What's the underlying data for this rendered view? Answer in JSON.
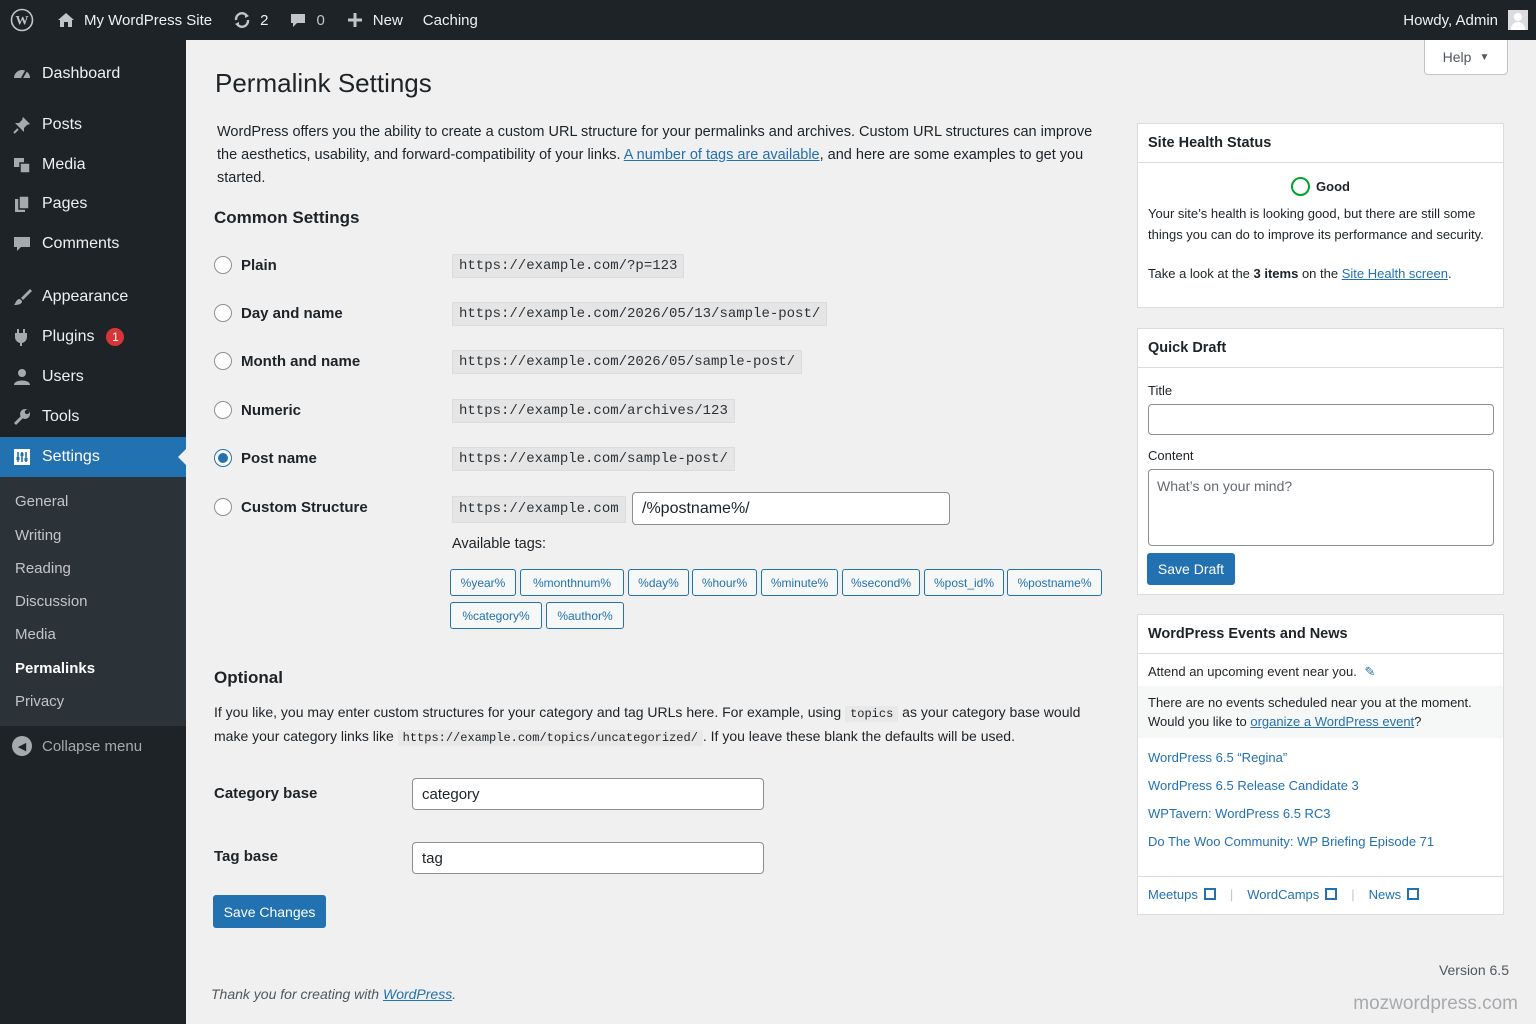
{
  "admin_bar": {
    "site_name": "My WordPress Site",
    "updates_count": "2",
    "comments_count": "0",
    "new_label": "New",
    "caching_label": "Caching",
    "howdy": "Howdy, Admin"
  },
  "sidebar": {
    "items": [
      {
        "label": "Dashboard",
        "icon": "dashboard-icon"
      },
      {
        "label": "Posts",
        "icon": "pin-icon"
      },
      {
        "label": "Media",
        "icon": "media-icon"
      },
      {
        "label": "Pages",
        "icon": "pages-icon"
      },
      {
        "label": "Comments",
        "icon": "comment-icon"
      },
      {
        "label": "Appearance",
        "icon": "brush-icon"
      },
      {
        "label": "Plugins",
        "icon": "plugin-icon",
        "badge": "1"
      },
      {
        "label": "Users",
        "icon": "user-icon"
      },
      {
        "label": "Tools",
        "icon": "wrench-icon"
      },
      {
        "label": "Settings",
        "icon": "settings-icon",
        "current": true
      }
    ],
    "submenu": [
      "General",
      "Writing",
      "Reading",
      "Discussion",
      "Media",
      "Permalinks",
      "Privacy"
    ],
    "collapse_label": "Collapse menu"
  },
  "help_label": "Help",
  "page": {
    "title": "Permalink Settings",
    "intro_before": "WordPress offers you the ability to create a custom URL structure for your permalinks and archives. Custom URL structures can improve the aesthetics, usability, and forward-compatibility of your links. ",
    "intro_link": "A number of tags are available",
    "intro_after": ", and here are some examples to get you started.",
    "common_heading": "Common Settings",
    "options": [
      {
        "label": "Plain",
        "example": "https://example.com/?p=123",
        "selected": false
      },
      {
        "label": "Day and name",
        "example": "https://example.com/2026/05/13/sample-post/",
        "selected": false
      },
      {
        "label": "Month and name",
        "example": "https://example.com/2026/05/sample-post/",
        "selected": false
      },
      {
        "label": "Numeric",
        "example": "https://example.com/archives/123",
        "selected": false
      },
      {
        "label": "Post name",
        "example": "https://example.com/sample-post/",
        "selected": true
      },
      {
        "label": "Custom Structure",
        "example": "https://example.com",
        "selected": false
      }
    ],
    "custom_structure_value": "/%postname%/",
    "available_tags_label": "Available tags:",
    "tags": [
      "%year%",
      "%monthnum%",
      "%day%",
      "%hour%",
      "%minute%",
      "%second%",
      "%post_id%",
      "%postname%",
      "%category%",
      "%author%"
    ],
    "optional_heading": "Optional",
    "optional_text_1": "If you like, you may enter custom structures for your category and tag URLs here. For example, using ",
    "optional_code_1": "topics",
    "optional_text_2": " as your category base would make your category links like ",
    "optional_code_2": "https://example.com/topics/uncategorized/",
    "optional_text_3": ". If you leave these blank the defaults will be used.",
    "category_base_label": "Category base",
    "category_base_value": "category",
    "tag_base_label": "Tag base",
    "tag_base_value": "tag",
    "save_label": "Save Changes"
  },
  "footer": {
    "thanks": "Thank you for creating with ",
    "link": "WordPress",
    "period": ".",
    "version": "Version 6.5",
    "watermark": "mozwordpress.com"
  },
  "site_health": {
    "title": "Site Health Status",
    "status": "Good",
    "text": "Your site’s health is looking good, but there are still some things you can do to improve its performance and security.",
    "take_look": "Take a look at the ",
    "items": "3 items",
    "on_the": " on the ",
    "link": "Site Health screen",
    "period": "."
  },
  "quick_draft": {
    "title": "Quick Draft",
    "title_label": "Title",
    "content_label": "Content",
    "content_placeholder": "What’s on your mind?",
    "save_label": "Save Draft"
  },
  "events": {
    "title": "WordPress Events and News",
    "attend": "Attend an upcoming event near you.",
    "none_text": "There are no events scheduled near you at the moment. Would you like to ",
    "none_link": "organize a WordPress event",
    "none_end": "?",
    "news": [
      "WordPress 6.5 “Regina”",
      "WordPress 6.5 Release Candidate 3",
      "WPTavern: WordPress 6.5 RC3",
      "Do The Woo Community: WP Briefing Episode 71"
    ],
    "footer_links": [
      "Meetups",
      "WordCamps",
      "News"
    ]
  },
  "colors": {
    "accent": "#2271b1",
    "sidebar_bg": "#1d2327",
    "badge": "#d63638"
  }
}
